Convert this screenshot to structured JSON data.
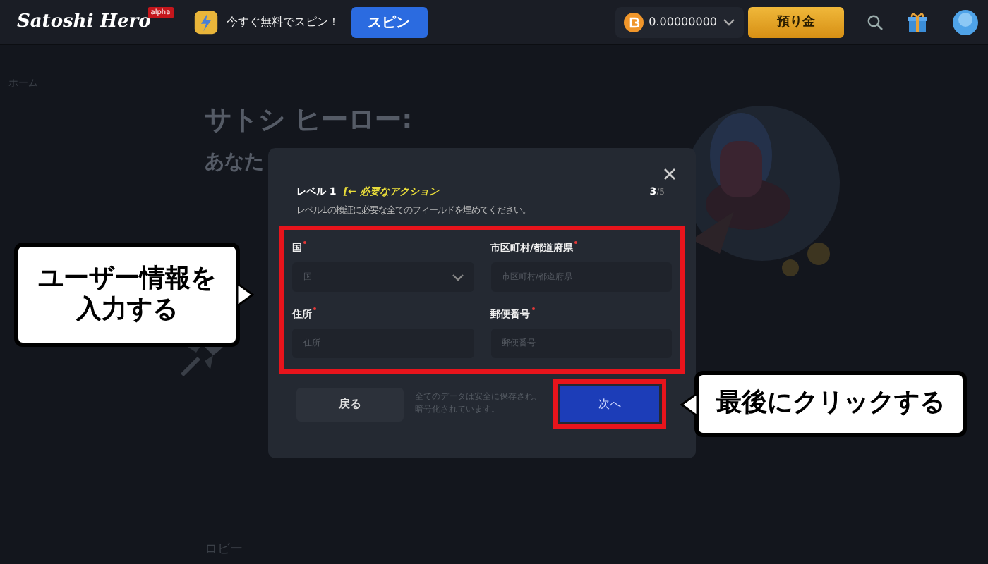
{
  "header": {
    "logo": "Satoshi Hero",
    "logo_badge": "alpha",
    "promo": "今すぐ無料でスピン！",
    "spin_button": "スピン",
    "balance": "0.00000000",
    "deposit_button": "預り金"
  },
  "sidebar": {
    "items": [
      "ホーム"
    ]
  },
  "hero": {
    "title": "サトシ ヒーロー:",
    "subtitle": "あなた"
  },
  "bottom_nav": {
    "items": [
      "ロビー"
    ]
  },
  "modal": {
    "level": "レベル 1",
    "required_action": "[← 必要なアクション",
    "step": "3",
    "step_total": "/5",
    "instruction": "レベル1の検証に必要な全てのフィールドを埋めてください。",
    "fields": [
      {
        "label": "国",
        "placeholder": "国",
        "kind": "select",
        "required": true
      },
      {
        "label": "市区町村/都道府県",
        "placeholder": "市区町村/都道府県",
        "kind": "text",
        "required": true
      },
      {
        "label": "住所",
        "placeholder": "住所",
        "kind": "text",
        "required": true
      },
      {
        "label": "郵便番号",
        "placeholder": "郵便番号",
        "kind": "text",
        "required": true
      }
    ],
    "back_button": "戻る",
    "note": "全てのデータは安全に保存され、暗号化されています。",
    "next_button": "次へ"
  },
  "callouts": [
    {
      "lines": [
        "ユーザー情報を",
        "入力する"
      ]
    },
    {
      "lines": [
        "最後にクリックする"
      ]
    }
  ]
}
